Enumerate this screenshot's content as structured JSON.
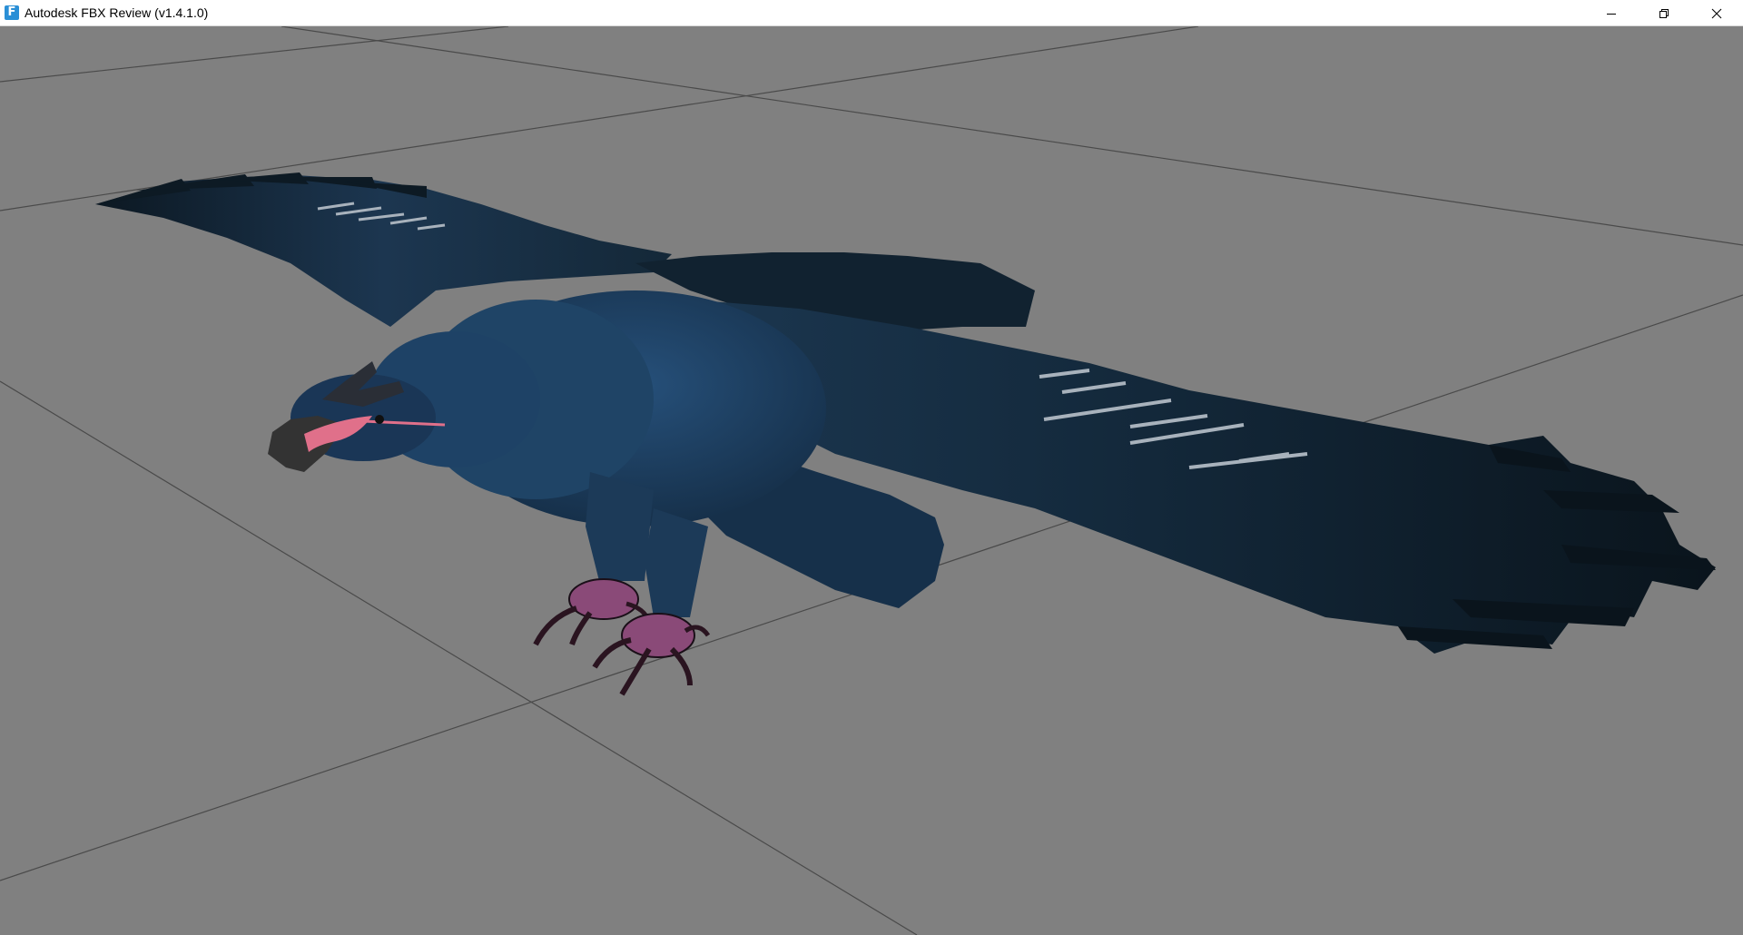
{
  "window": {
    "title": "Autodesk FBX Review (v1.4.1.0)",
    "icon": "fbx-app-icon",
    "icon_glyph": "F",
    "controls": [
      "minimize-icon",
      "restore-icon",
      "close-icon"
    ]
  },
  "viewport": {
    "background_color": "#808080",
    "grid_color": "#4a4a4a",
    "model": {
      "description_icon": "eagle-model",
      "body_color": "#1f3a55",
      "feather_dark_color": "#0f1c26",
      "beak_color": "#3a3a3a",
      "mouth_color": "#e0708a",
      "talon_color": "#8a4a78"
    }
  }
}
